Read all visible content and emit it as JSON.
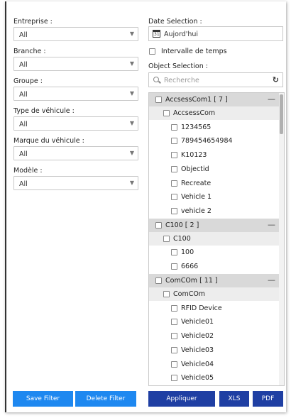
{
  "filters": {
    "entreprise": {
      "label": "Entreprise :",
      "value": "All"
    },
    "branche": {
      "label": "Branche :",
      "value": "All"
    },
    "groupe": {
      "label": "Groupe :",
      "value": "All"
    },
    "type_vehicule": {
      "label": "Type de véhicule :",
      "value": "All"
    },
    "marque_vehicule": {
      "label": "Marque du véhicule :",
      "value": "All"
    },
    "modele": {
      "label": "Modèle :",
      "value": "All"
    }
  },
  "date": {
    "label": "Date Selection :",
    "value": "Aujord'hui",
    "intervalle_label": "Intervalle de temps"
  },
  "object_selection": {
    "label": "Object Selection :",
    "search_placeholder": "Recherche"
  },
  "tree": {
    "group1": {
      "label": "AccsessCom1 [ 7 ]",
      "sub": "AccsessCom",
      "items": [
        "1234565",
        "789454654984",
        "K10123",
        "Objectid",
        "Recreate",
        "Vehicle 1",
        "vehicle 2"
      ]
    },
    "group2": {
      "label": "C100 [ 2 ]",
      "sub": "C100",
      "items": [
        "100",
        "6666"
      ]
    },
    "group3": {
      "label": "ComCOm [ 11 ]",
      "sub": "ComCOm",
      "items": [
        "RFID Device",
        "Vehicle01",
        "Vehicle02",
        "Vehicle03",
        "Vehicle04",
        "Vehicle05"
      ]
    }
  },
  "buttons": {
    "save_filter": "Save Filter",
    "delete_filter": "Delete Filter",
    "appliquer": "Appliquer",
    "xls": "XLS",
    "pdf": "PDF"
  },
  "colors": {
    "button_light": "#1e88f0",
    "button_dark": "#1f3fa3"
  }
}
